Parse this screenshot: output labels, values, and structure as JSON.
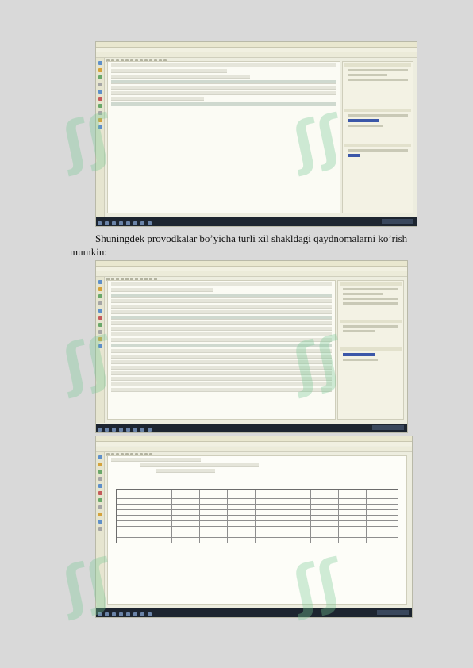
{
  "document": {
    "paragraph": "Shuningdek provodkalar bo’yicha turli xil shakldagi qaydnomalarni ko’rish mumkin:"
  },
  "screenshots": [
    {
      "id": "shot-1",
      "kind": "report-window"
    },
    {
      "id": "shot-2",
      "kind": "ledger-window"
    },
    {
      "id": "shot-3",
      "kind": "statement-grid-window"
    }
  ],
  "colors": {
    "page": "#d9d9d9",
    "window": "#ededdf",
    "taskbar": "#1d2530",
    "selection": "#3b57a8",
    "watermark": "#78c896"
  },
  "watermark": {
    "glyph": "ʃʃ"
  }
}
